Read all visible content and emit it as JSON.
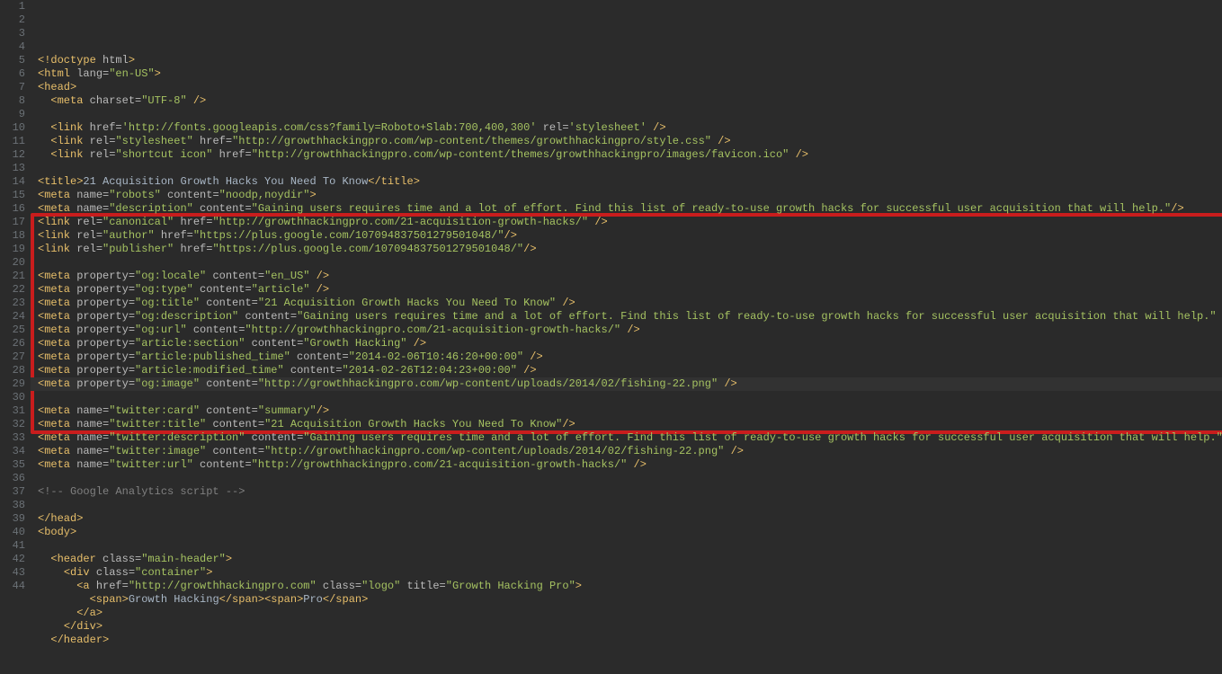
{
  "highlight_start": 17,
  "highlight_end": 32,
  "caret_line": 29,
  "lines": [
    {
      "n": 1,
      "i": 0,
      "t": [
        [
          "tag",
          "<!doctype "
        ],
        [
          "attr",
          "html"
        ],
        [
          "tag",
          ">"
        ]
      ]
    },
    {
      "n": 2,
      "i": 0,
      "t": [
        [
          "tag",
          "<html "
        ],
        [
          "attr",
          "lang="
        ],
        [
          "val",
          "\"en-US\""
        ],
        [
          "tag",
          ">"
        ]
      ]
    },
    {
      "n": 3,
      "i": 0,
      "t": [
        [
          "tag",
          "<head>"
        ]
      ]
    },
    {
      "n": 4,
      "i": 1,
      "t": [
        [
          "tag",
          "<meta "
        ],
        [
          "attr",
          "charset="
        ],
        [
          "val",
          "\"UTF-8\""
        ],
        [
          "tag",
          " />"
        ]
      ]
    },
    {
      "n": 5,
      "i": 0,
      "t": []
    },
    {
      "n": 6,
      "i": 1,
      "t": [
        [
          "tag",
          "<link "
        ],
        [
          "attr",
          "href="
        ],
        [
          "val",
          "'http://fonts.googleapis.com/css?family=Roboto+Slab:700,400,300'"
        ],
        [
          "attr",
          " rel="
        ],
        [
          "val",
          "'stylesheet'"
        ],
        [
          "tag",
          " />"
        ]
      ]
    },
    {
      "n": 7,
      "i": 1,
      "t": [
        [
          "tag",
          "<link "
        ],
        [
          "attr",
          "rel="
        ],
        [
          "val",
          "\"stylesheet\""
        ],
        [
          "attr",
          " href="
        ],
        [
          "val",
          "\"http://growthhackingpro.com/wp-content/themes/growthhackingpro/style.css\""
        ],
        [
          "tag",
          " />"
        ]
      ]
    },
    {
      "n": 8,
      "i": 1,
      "t": [
        [
          "tag",
          "<link "
        ],
        [
          "attr",
          "rel="
        ],
        [
          "val",
          "\"shortcut icon\""
        ],
        [
          "attr",
          " href="
        ],
        [
          "val",
          "\"http://growthhackingpro.com/wp-content/themes/growthhackingpro/images/favicon.ico\""
        ],
        [
          "tag",
          " />"
        ]
      ]
    },
    {
      "n": 9,
      "i": 0,
      "t": []
    },
    {
      "n": 10,
      "i": 0,
      "t": [
        [
          "tag",
          "<title>"
        ],
        [
          "txt",
          "21 Acquisition Growth Hacks You Need To Know"
        ],
        [
          "tag",
          "</title>"
        ]
      ]
    },
    {
      "n": 11,
      "i": 0,
      "t": [
        [
          "tag",
          "<meta "
        ],
        [
          "attr",
          "name="
        ],
        [
          "val",
          "\"robots\""
        ],
        [
          "attr",
          " content="
        ],
        [
          "val",
          "\"noodp,noydir\""
        ],
        [
          "tag",
          ">"
        ]
      ]
    },
    {
      "n": 12,
      "i": 0,
      "t": [
        [
          "tag",
          "<meta "
        ],
        [
          "attr",
          "name="
        ],
        [
          "val",
          "\"description\""
        ],
        [
          "attr",
          " content="
        ],
        [
          "val",
          "\"Gaining users requires time and a lot of effort. Find this list of ready-to-use growth hacks for successful user acquisition that will help.\""
        ],
        [
          "tag",
          "/>"
        ]
      ]
    },
    {
      "n": 13,
      "i": 0,
      "t": [
        [
          "tag",
          "<link "
        ],
        [
          "attr",
          "rel="
        ],
        [
          "val",
          "\"canonical\""
        ],
        [
          "attr",
          " href="
        ],
        [
          "val",
          "\"http://growthhackingpro.com/21-acquisition-growth-hacks/\""
        ],
        [
          "tag",
          " />"
        ]
      ]
    },
    {
      "n": 14,
      "i": 0,
      "t": [
        [
          "tag",
          "<link "
        ],
        [
          "attr",
          "rel="
        ],
        [
          "val",
          "\"author\""
        ],
        [
          "attr",
          " href="
        ],
        [
          "val",
          "\"https://plus.google.com/107094837501279501048/\""
        ],
        [
          "tag",
          "/>"
        ]
      ]
    },
    {
      "n": 15,
      "i": 0,
      "t": [
        [
          "tag",
          "<link "
        ],
        [
          "attr",
          "rel="
        ],
        [
          "val",
          "\"publisher\""
        ],
        [
          "attr",
          " href="
        ],
        [
          "val",
          "\"https://plus.google.com/107094837501279501048/\""
        ],
        [
          "tag",
          "/>"
        ]
      ]
    },
    {
      "n": 16,
      "i": 0,
      "t": []
    },
    {
      "n": 17,
      "i": 0,
      "t": [
        [
          "tag",
          "<meta "
        ],
        [
          "attr",
          "property="
        ],
        [
          "val",
          "\"og:locale\""
        ],
        [
          "attr",
          " content="
        ],
        [
          "val",
          "\"en_US\""
        ],
        [
          "tag",
          " />"
        ]
      ]
    },
    {
      "n": 18,
      "i": 0,
      "t": [
        [
          "tag",
          "<meta "
        ],
        [
          "attr",
          "property="
        ],
        [
          "val",
          "\"og:type\""
        ],
        [
          "attr",
          " content="
        ],
        [
          "val",
          "\"article\""
        ],
        [
          "tag",
          " />"
        ]
      ]
    },
    {
      "n": 19,
      "i": 0,
      "t": [
        [
          "tag",
          "<meta "
        ],
        [
          "attr",
          "property="
        ],
        [
          "val",
          "\"og:title\""
        ],
        [
          "attr",
          " content="
        ],
        [
          "val",
          "\"21 Acquisition Growth Hacks You Need To Know\""
        ],
        [
          "tag",
          " />"
        ]
      ]
    },
    {
      "n": 20,
      "i": 0,
      "t": [
        [
          "tag",
          "<meta "
        ],
        [
          "attr",
          "property="
        ],
        [
          "val",
          "\"og:description\""
        ],
        [
          "attr",
          " content="
        ],
        [
          "val",
          "\"Gaining users requires time and a lot of effort. Find this list of ready-to-use growth hacks for successful user acquisition that will help.\""
        ],
        [
          "tag",
          " />"
        ]
      ]
    },
    {
      "n": 21,
      "i": 0,
      "t": [
        [
          "tag",
          "<meta "
        ],
        [
          "attr",
          "property="
        ],
        [
          "val",
          "\"og:url\""
        ],
        [
          "attr",
          " content="
        ],
        [
          "val",
          "\"http://growthhackingpro.com/21-acquisition-growth-hacks/\""
        ],
        [
          "tag",
          " />"
        ]
      ]
    },
    {
      "n": 22,
      "i": 0,
      "t": [
        [
          "tag",
          "<meta "
        ],
        [
          "attr",
          "property="
        ],
        [
          "val",
          "\"article:section\""
        ],
        [
          "attr",
          " content="
        ],
        [
          "val",
          "\"Growth Hacking\""
        ],
        [
          "tag",
          " />"
        ]
      ]
    },
    {
      "n": 23,
      "i": 0,
      "t": [
        [
          "tag",
          "<meta "
        ],
        [
          "attr",
          "property="
        ],
        [
          "val",
          "\"article:published_time\""
        ],
        [
          "attr",
          " content="
        ],
        [
          "val",
          "\"2014-02-06T10:46:20+00:00\""
        ],
        [
          "tag",
          " />"
        ]
      ]
    },
    {
      "n": 24,
      "i": 0,
      "t": [
        [
          "tag",
          "<meta "
        ],
        [
          "attr",
          "property="
        ],
        [
          "val",
          "\"article:modified_time\""
        ],
        [
          "attr",
          " content="
        ],
        [
          "val",
          "\"2014-02-26T12:04:23+00:00\""
        ],
        [
          "tag",
          " />"
        ]
      ]
    },
    {
      "n": 25,
      "i": 0,
      "t": [
        [
          "tag",
          "<meta "
        ],
        [
          "attr",
          "property="
        ],
        [
          "val",
          "\"og:image\""
        ],
        [
          "attr",
          " content="
        ],
        [
          "val",
          "\"http://growthhackingpro.com/wp-content/uploads/2014/02/fishing-22.png\""
        ],
        [
          "tag",
          " />"
        ]
      ]
    },
    {
      "n": 26,
      "i": 0,
      "t": []
    },
    {
      "n": 27,
      "i": 0,
      "t": [
        [
          "tag",
          "<meta "
        ],
        [
          "attr",
          "name="
        ],
        [
          "val",
          "\"twitter:card\""
        ],
        [
          "attr",
          " content="
        ],
        [
          "val",
          "\"summary\""
        ],
        [
          "tag",
          "/>"
        ]
      ]
    },
    {
      "n": 28,
      "i": 0,
      "t": [
        [
          "tag",
          "<meta "
        ],
        [
          "attr",
          "name="
        ],
        [
          "val",
          "\"twitter:title\""
        ],
        [
          "attr",
          " content="
        ],
        [
          "val",
          "\"21 Acquisition Growth Hacks You Need To Know\""
        ],
        [
          "tag",
          "/>"
        ]
      ]
    },
    {
      "n": 29,
      "i": 0,
      "t": [
        [
          "tag",
          "<meta "
        ],
        [
          "attr",
          "name="
        ],
        [
          "val",
          "\"twitter:description\""
        ],
        [
          "attr",
          " content="
        ],
        [
          "val",
          "\"Gaining users requires time and a lot of effort. Find this list of ready-to-use growth hacks for successful user acquisition that will help.\""
        ],
        [
          "tag",
          " />"
        ]
      ]
    },
    {
      "n": 30,
      "i": 0,
      "t": [
        [
          "tag",
          "<meta "
        ],
        [
          "attr",
          "name="
        ],
        [
          "val",
          "\"twitter:image\""
        ],
        [
          "attr",
          " content="
        ],
        [
          "val",
          "\"http://growthhackingpro.com/wp-content/uploads/2014/02/fishing-22.png\""
        ],
        [
          "tag",
          " />"
        ]
      ]
    },
    {
      "n": 31,
      "i": 0,
      "t": [
        [
          "tag",
          "<meta "
        ],
        [
          "attr",
          "name="
        ],
        [
          "val",
          "\"twitter:url\""
        ],
        [
          "attr",
          " content="
        ],
        [
          "val",
          "\"http://growthhackingpro.com/21-acquisition-growth-hacks/\""
        ],
        [
          "tag",
          " />"
        ]
      ]
    },
    {
      "n": 32,
      "i": 0,
      "t": []
    },
    {
      "n": 33,
      "i": 0,
      "t": [
        [
          "cmt",
          "<!-- Google Analytics script -->"
        ]
      ]
    },
    {
      "n": 34,
      "i": 0,
      "t": []
    },
    {
      "n": 35,
      "i": 0,
      "t": [
        [
          "tag",
          "</head>"
        ]
      ]
    },
    {
      "n": 36,
      "i": 0,
      "t": [
        [
          "tag",
          "<body>"
        ]
      ]
    },
    {
      "n": 37,
      "i": 0,
      "t": []
    },
    {
      "n": 38,
      "i": 1,
      "t": [
        [
          "tag",
          "<header "
        ],
        [
          "attr",
          "class="
        ],
        [
          "val",
          "\"main-header\""
        ],
        [
          "tag",
          ">"
        ]
      ]
    },
    {
      "n": 39,
      "i": 2,
      "t": [
        [
          "tag",
          "<div "
        ],
        [
          "attr",
          "class="
        ],
        [
          "val",
          "\"container\""
        ],
        [
          "tag",
          ">"
        ]
      ]
    },
    {
      "n": 40,
      "i": 3,
      "t": [
        [
          "tag",
          "<a "
        ],
        [
          "attr",
          "href="
        ],
        [
          "val",
          "\"http://growthhackingpro.com\""
        ],
        [
          "attr",
          " class="
        ],
        [
          "val",
          "\"logo\""
        ],
        [
          "attr",
          " title="
        ],
        [
          "val",
          "\"Growth Hacking Pro\""
        ],
        [
          "tag",
          ">"
        ]
      ]
    },
    {
      "n": 41,
      "i": 4,
      "t": [
        [
          "tag",
          "<span>"
        ],
        [
          "txt",
          "Growth Hacking"
        ],
        [
          "tag",
          "</span><span>"
        ],
        [
          "txt",
          "Pro"
        ],
        [
          "tag",
          "</span>"
        ]
      ]
    },
    {
      "n": 42,
      "i": 3,
      "t": [
        [
          "tag",
          "</a>"
        ]
      ]
    },
    {
      "n": 43,
      "i": 2,
      "t": [
        [
          "tag",
          "</div>"
        ]
      ]
    },
    {
      "n": 44,
      "i": 1,
      "t": [
        [
          "tag",
          "</header>"
        ]
      ]
    }
  ]
}
